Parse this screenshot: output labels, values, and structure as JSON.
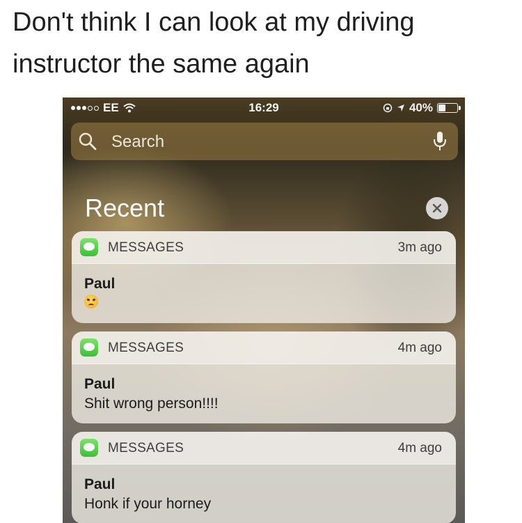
{
  "caption": {
    "line1": "Don't think I can look at my driving",
    "line2": "instructor the same again"
  },
  "status_bar": {
    "signal_dots_filled": 3,
    "signal_dots_total": 5,
    "carrier": "EE",
    "time": "16:29",
    "battery_percent": "40%",
    "battery_level": 0.4,
    "icons": [
      "wifi-icon",
      "lock-rotation-icon",
      "location-arrow-icon",
      "battery-icon"
    ]
  },
  "search": {
    "placeholder": "Search",
    "icons": [
      "search-icon",
      "microphone-icon"
    ]
  },
  "recent": {
    "title": "Recent",
    "clear_icon": "close-icon"
  },
  "notifications": [
    {
      "app": "MESSAGES",
      "time_ago": "3m ago",
      "sender": "Paul",
      "message": "",
      "emoji": "angry-face-emoji"
    },
    {
      "app": "MESSAGES",
      "time_ago": "4m ago",
      "sender": "Paul",
      "message": "Shit wrong person!!!!"
    },
    {
      "app": "MESSAGES",
      "time_ago": "4m ago",
      "sender": "Paul",
      "message": "Honk if your horney"
    }
  ],
  "colors": {
    "app_icon": "#4cd964",
    "caption_text": "#1f1f1f"
  }
}
